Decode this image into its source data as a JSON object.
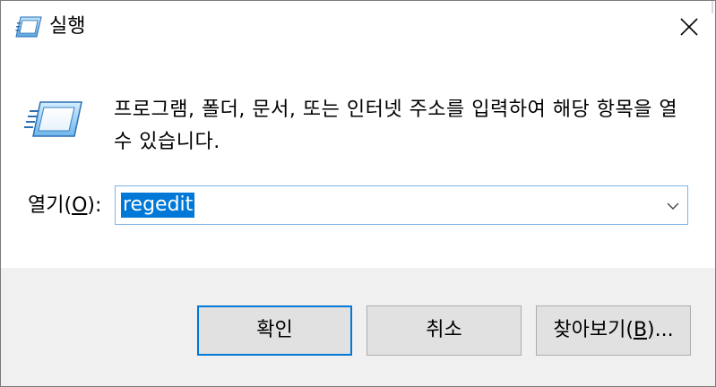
{
  "window": {
    "title": "실행",
    "close_icon": "close-icon",
    "title_icon": "run-icon"
  },
  "body": {
    "description": "프로그램, 폴더, 문서, 또는 인터넷 주소를 입력하여 해당 항목을 열 수 있습니다.",
    "open_label_prefix": "열기(",
    "open_label_hotkey": "O",
    "open_label_suffix": "):",
    "input_value": "regedit",
    "dropdown_icon": "chevron-down-icon"
  },
  "buttons": {
    "ok_label": "확인",
    "cancel_label": "취소",
    "browse_prefix": "찾아보기(",
    "browse_hotkey": "B",
    "browse_suffix": ")..."
  },
  "colors": {
    "accent": "#0078d7",
    "footer_bg": "#f0f0f0",
    "button_bg": "#e1e1e1"
  }
}
